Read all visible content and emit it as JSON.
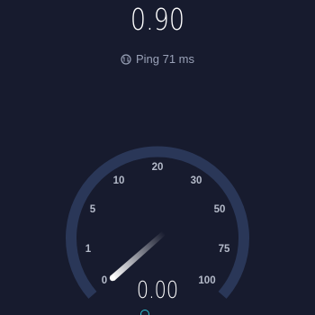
{
  "download": {
    "value": "0.90"
  },
  "ping": {
    "label": "Ping 71 ms",
    "icon": "ping-icon"
  },
  "gauge": {
    "ticks": [
      "0",
      "1",
      "5",
      "10",
      "20",
      "30",
      "50",
      "75",
      "100"
    ],
    "current_value": "0.00",
    "track_color": "#2a3758",
    "needle_color": "#ffffff",
    "background_color": "#171b2e"
  },
  "unit_icon": "upload-icon",
  "accent_color": "#2ec4d6"
}
